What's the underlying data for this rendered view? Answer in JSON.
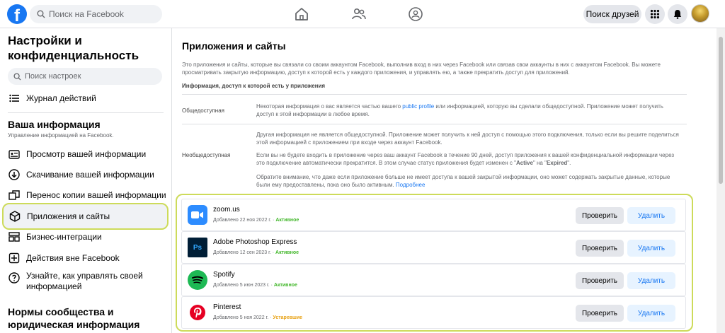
{
  "topbar": {
    "logo_letter": "f",
    "search_placeholder": "Поиск на Facebook",
    "find_friends_label": "Поиск друзей",
    "nav_icons": [
      "home-icon",
      "friends-icon",
      "groups-icon"
    ],
    "right_icons": [
      "menu-grid-icon",
      "notifications-bell-icon",
      "avatar"
    ]
  },
  "sidebar": {
    "title": "Настройки и конфиденциальность",
    "search_placeholder": "Поиск настроек",
    "activity_log": "Журнал действий",
    "section_title": "Ваша информация",
    "section_subtitle": "Управление информацией на Facebook.",
    "items": [
      {
        "label": "Просмотр вашей информации",
        "icon": "info-card-icon"
      },
      {
        "label": "Скачивание вашей информации",
        "icon": "download-icon"
      },
      {
        "label": "Перенос копии вашей информации",
        "icon": "transfer-icon"
      },
      {
        "label": "Приложения и сайты",
        "icon": "cube-icon",
        "active": true
      },
      {
        "label": "Бизнес-интеграции",
        "icon": "business-icon"
      },
      {
        "label": "Действия вне Facebook",
        "icon": "off-facebook-icon"
      },
      {
        "label": "Узнайте, как управлять своей информацией",
        "icon": "help-icon"
      }
    ],
    "norms_title": "Нормы сообщества и юридическая информация"
  },
  "main": {
    "title": "Приложения и сайты",
    "description": "Это приложения и сайты, которые вы связали со своим аккаунтом Facebook, выполнив вход в них через Facebook или связав свои аккаунты в них с аккаунтом Facebook. Вы можете просматривать закрытую информацию, доступ к которой есть у каждого приложения, и управлять ею, а также прекратить доступ для приложений.",
    "info_heading": "Информация, доступ к которой есть у приложения",
    "public": {
      "label": "Общедоступная",
      "text_before": "Некоторая информация о вас является частью вашего ",
      "link": "public profile",
      "text_after": " или информацией, которую вы сделали общедоступной. Приложение может получить доступ к этой информации в любое время."
    },
    "nonpublic": {
      "label": "Необщедоступная",
      "p1": "Другая информация не является общедоступной. Приложение может получить к ней доступ с помощью этого подключения, только если вы решите поделиться этой информацией с приложением при входе через аккаунт Facebook.",
      "p2_a": "Если вы не будете входить в приложение через ваш аккаунт Facebook в течение 90 дней, доступ приложения к вашей конфиденциальной информации через это подключение автоматически прекратится. В этом случае статус приложения будет изменен с \"",
      "p2_active": "Active",
      "p2_b": "\" на \"",
      "p2_expired": "Expired",
      "p2_c": "\".",
      "p3": "Обратите внимание, что даже если приложение больше не имеет доступа к вашей закрытой информации, оно может содержать закрытые данные, которые были ему предоставлены, пока оно было активным. ",
      "p3_link": "Подробнее"
    },
    "review_label": "Проверить",
    "remove_label": "Удалить",
    "apps": [
      {
        "name": "zoom.us",
        "added": "Добавлено 22 ноя 2022 г. · ",
        "status": "Активное",
        "status_color": "#42b72a",
        "icon": "zoom-icon"
      },
      {
        "name": "Adobe Photoshop Express",
        "added": "Добавлено 12 сен 2023 г. · ",
        "status": "Активное",
        "status_color": "#42b72a",
        "icon": "photoshop-icon"
      },
      {
        "name": "Spotify",
        "added": "Добавлено 5 июн 2023 г. · ",
        "status": "Активное",
        "status_color": "#42b72a",
        "icon": "spotify-icon"
      },
      {
        "name": "Pinterest",
        "added": "Добавлено 5 ноя 2022 г. · ",
        "status": "Устаревшие",
        "status_color": "#e8a317",
        "icon": "pinterest-icon"
      }
    ]
  },
  "colors": {
    "accent": "#1877f2",
    "highlight_border": "#cddb5a",
    "active_status": "#42b72a",
    "expired_status": "#e8a317"
  }
}
